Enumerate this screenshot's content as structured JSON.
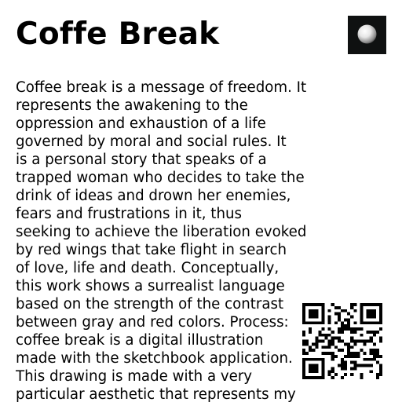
{
  "header": {
    "title": "Coffe Break"
  },
  "artwork_thumbnail": {
    "icon": "moon-sphere-icon",
    "background_color": "#0f1111"
  },
  "body": {
    "lines": [
      "Coffee break is a message of freedom. It",
      "represents the awakening to the",
      "oppression and exhaustion of a life",
      "governed by moral and social rules. It",
      "is a personal story that speaks of a",
      "trapped woman who decides to take the",
      "drink of ideas and drown her enemies,",
      "fears and frustrations in it, thus",
      "seeking to achieve the liberation evoked",
      "by red wings that take flight in search",
      "of love, life and death. Conceptually,",
      "this work shows a surrealist language",
      "based on the strength of the contrast",
      "between gray and red colors. Process:",
      "coffee break is a digital illustration",
      "made with the sketchbook application.",
      "This drawing is made with a very",
      "particular aesthetic that represents my"
    ]
  },
  "qr_code": {
    "icon": "qr-code-icon"
  }
}
